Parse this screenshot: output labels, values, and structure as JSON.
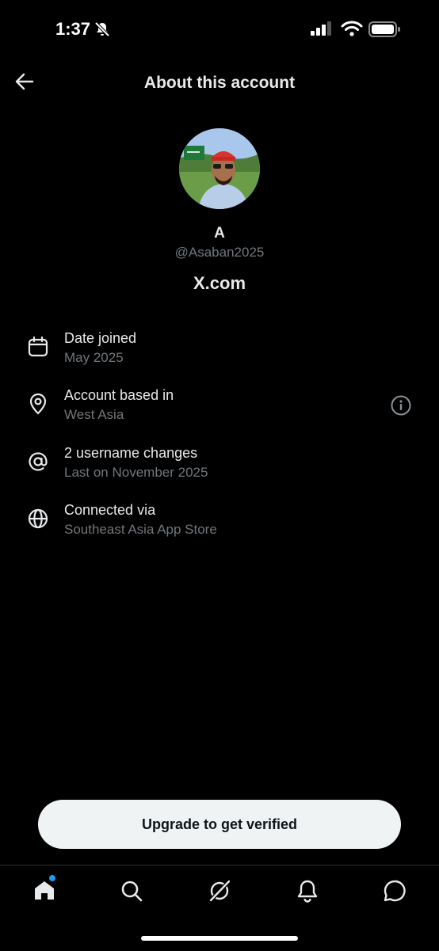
{
  "status_bar": {
    "time": "1:37"
  },
  "header": {
    "title": "About this account"
  },
  "profile": {
    "display_name": "A",
    "handle": "@Asaban2025",
    "site": "X.com"
  },
  "info": [
    {
      "icon": "calendar-icon",
      "label": "Date joined",
      "value": "May 2025"
    },
    {
      "icon": "location-pin-icon",
      "label": "Account based in",
      "value": "West Asia"
    },
    {
      "icon": "at-sign-icon",
      "label": "2 username changes",
      "value": "Last on November 2025"
    },
    {
      "icon": "globe-icon",
      "label": "Connected via",
      "value": "Southeast Asia App Store"
    }
  ],
  "upgrade": {
    "label": "Upgrade to get verified"
  },
  "tabs": [
    "home-icon",
    "search-icon",
    "grok-icon",
    "notifications-icon",
    "messages-icon"
  ],
  "colors": {
    "background": "#000000",
    "text": "#e7e9ea",
    "muted": "#71767b",
    "accent": "#1d9bf0",
    "button": "#eff3f4"
  }
}
